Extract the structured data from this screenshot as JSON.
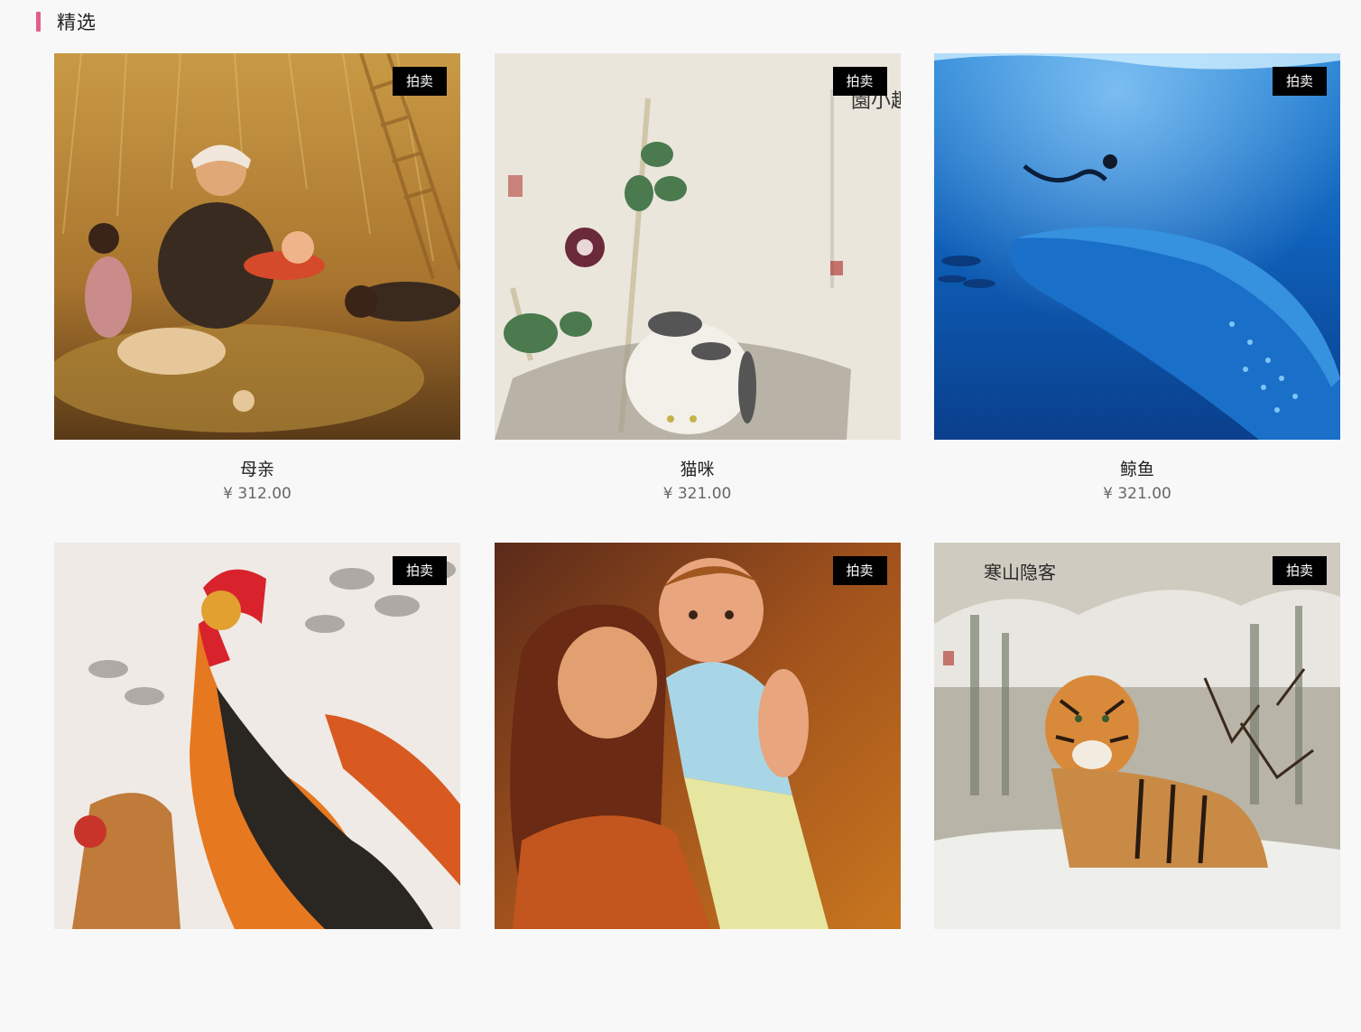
{
  "section": {
    "title": "精选"
  },
  "products": [
    {
      "name": "母亲",
      "price": "¥ 312.00",
      "badge": "拍卖"
    },
    {
      "name": "猫咪",
      "price": "¥ 321.00",
      "badge": "拍卖"
    },
    {
      "name": "鲸鱼",
      "price": "¥ 321.00",
      "badge": "拍卖"
    },
    {
      "name": "",
      "price": "",
      "badge": "拍卖"
    },
    {
      "name": "",
      "price": "",
      "badge": "拍卖"
    },
    {
      "name": "",
      "price": "",
      "badge": "拍卖"
    }
  ],
  "colors": {
    "accent": "#e35d8c",
    "badge_bg": "#000000",
    "page_bg": "#f8f8f8"
  }
}
